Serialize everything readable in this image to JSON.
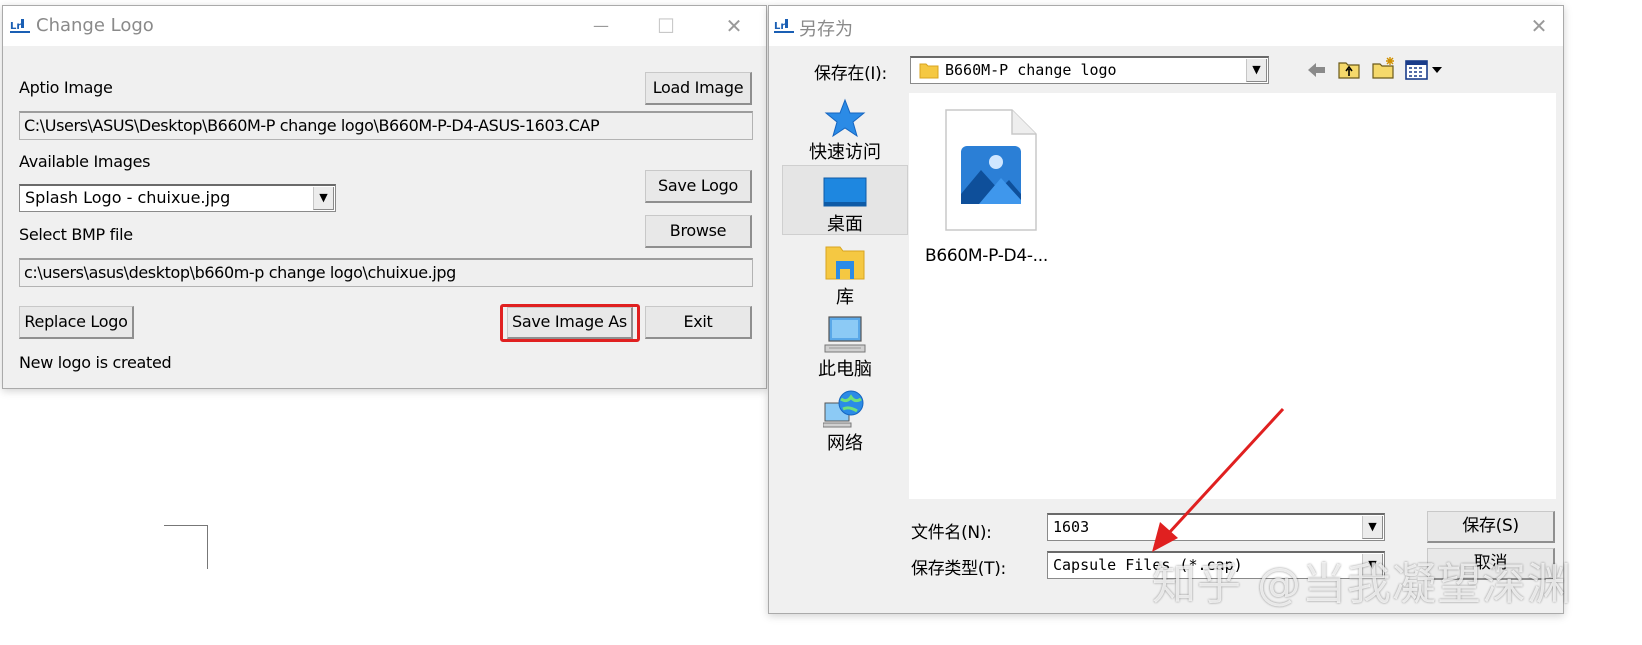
{
  "change_logo": {
    "title": "Change Logo",
    "aptio_label": "Aptio Image",
    "load_button": "Load Image",
    "aptio_path": "C:\\Users\\ASUS\\Desktop\\B660M-P change logo\\B660M-P-D4-ASUS-1603.CAP",
    "available_label": "Available Images",
    "available_selected": "Splash Logo - chuixue.jpg",
    "save_logo_button": "Save Logo",
    "browse_button": "Browse",
    "bmp_label": "Select BMP file",
    "bmp_path": "c:\\users\\asus\\desktop\\b660m-p change logo\\chuixue.jpg",
    "replace_button": "Replace Logo",
    "save_image_as_button": "Save Image As",
    "exit_button": "Exit",
    "status": "New logo is created",
    "minimize_glyph": "—",
    "maximize_glyph": "☐",
    "close_glyph": "✕"
  },
  "save_as": {
    "title": "另存为",
    "close_glyph": "✕",
    "save_in_label": "保存在(I):",
    "save_in_value": "B660M-P change logo",
    "sidebar": [
      {
        "label": "快速访问",
        "icon": "star-icon"
      },
      {
        "label": "桌面",
        "icon": "desktop-icon"
      },
      {
        "label": "库",
        "icon": "library-folder-icon"
      },
      {
        "label": "此电脑",
        "icon": "computer-icon"
      },
      {
        "label": "网络",
        "icon": "network-globe-icon"
      }
    ],
    "file_item": "B660M-P-D4-...",
    "filename_label": "文件名(N):",
    "filename_value": "1603",
    "filetype_label": "保存类型(T):",
    "filetype_value": "Capsule Files (*.cap)",
    "save_button": "保存(S)",
    "cancel_button": "取消"
  },
  "watermark": "知乎 @当我凝望深渊",
  "colors": {
    "highlight_red": "#e02020",
    "desktop_blue": "#1e87e0",
    "folder_yellow": "#f5c842"
  }
}
